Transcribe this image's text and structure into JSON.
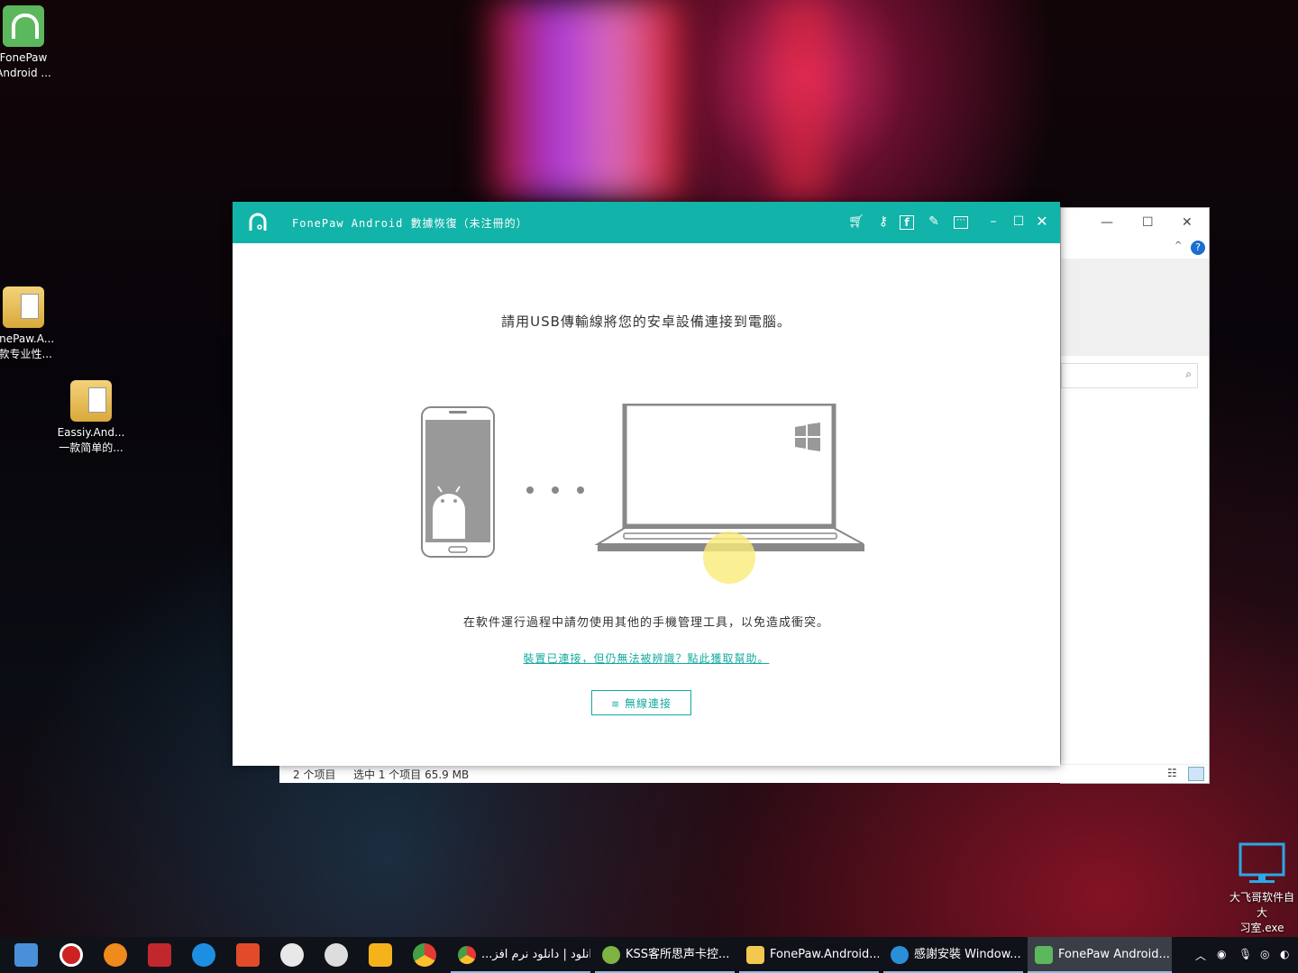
{
  "desktop": {
    "icons": [
      {
        "line1": "FonePaw",
        "line2": "Android ..."
      },
      {
        "line1": "onePaw.A...",
        "line2": "-款专业性..."
      },
      {
        "line1": "Eassiy.And...",
        "line2": "一款简单的..."
      }
    ],
    "monitor_icon": {
      "line1": "大飞哥软件自 大",
      "line2": "习室.exe"
    }
  },
  "app": {
    "title": "FonePaw Android 數據恢復（未注冊的）",
    "instruction": "請用USB傳輸線將您的安卓設備連接到電腦。",
    "warning": "在軟件運行過程中請勿使用其他的手機管理工具，以免造成衝突。",
    "help_link": "裝置已連接，但仍無法被辨識？點此獲取幫助。",
    "wifi_button": "無線連接",
    "toolbar_icons": [
      "cart-icon",
      "key-icon",
      "facebook-icon",
      "feedback-icon",
      "menu-icon"
    ],
    "accent": "#12b3a8"
  },
  "explorer": {
    "status_items": "2 个项目",
    "status_selected": "选中 1 个项目  65.9 MB"
  },
  "taskbar": {
    "tasks": [
      {
        "label": "...ياس دانلود | دانلود نرم افز"
      },
      {
        "label": "KSS客所思声卡控..."
      },
      {
        "label": "FonePaw.Android..."
      },
      {
        "label": "感謝安裝 Window..."
      },
      {
        "label": "FonePaw Android..."
      }
    ]
  }
}
